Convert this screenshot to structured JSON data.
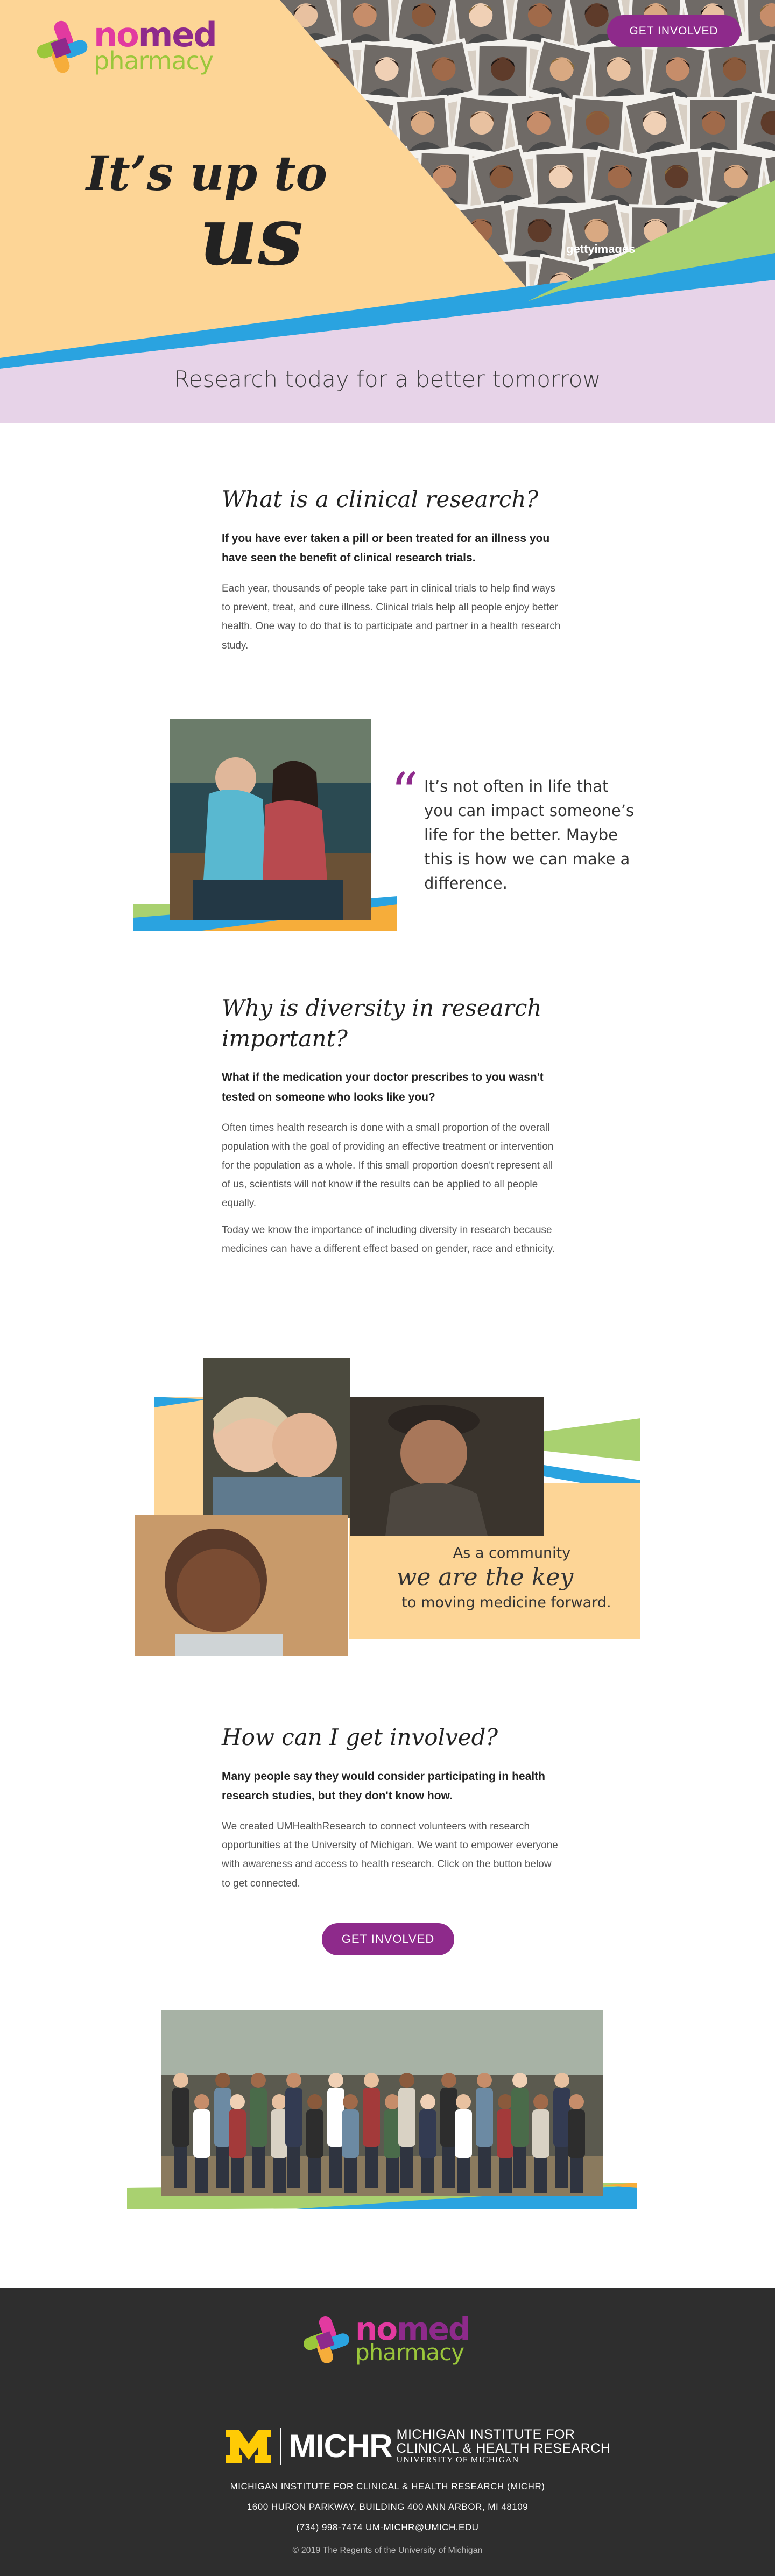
{
  "brand": {
    "logo_no": "no",
    "logo_med": "med",
    "logo_pharmacy": "pharmacy"
  },
  "header": {
    "cta_label": "GET INVOLVED"
  },
  "hero": {
    "title_line1": "It’s up to",
    "title_line2": "us",
    "tagline": "Research today for a better tomorrow",
    "watermark": "gettyimages"
  },
  "section_clinical": {
    "heading": "What is a clinical research?",
    "lead": "If you have ever taken a pill or been treated for an illness you have seen the benefit of clinical research trials.",
    "body": "Each year, thousands of people take part in clinical trials to help find ways to prevent, treat, and cure illness. Clinical trials help all people enjoy better health. One way to do that is to participate and partner in a health research study."
  },
  "quote": {
    "mark": "“",
    "text": "It’s not often in life that you can impact someone’s life for the better. Maybe this is how we can make a difference."
  },
  "section_diversity": {
    "heading": "Why is diversity in research important?",
    "lead": "What if the medication your doctor prescribes to you wasn't tested on someone who looks like you?",
    "body1": "Often times health research is done with a small proportion of the overall population with the goal of providing an effective treatment or intervention for the population as a whole. If this small proportion doesn't represent all of us, scientists will not know if the results can be applied to all people equally.",
    "body2": "Today we know the importance of including diversity in research because medicines can have a different effect based on gender, race and ethnicity."
  },
  "community": {
    "line1": "As a community",
    "line2": "we are the key",
    "line3": "to moving medicine forward."
  },
  "section_involved": {
    "heading": "How can I get involved?",
    "lead": "Many people say they would consider participating in health research studies, but they don't know how.",
    "body": "We created UMHealthResearch to connect volunteers with research opportunities at the University of Michigan. We want to empower everyone with awareness and access to health research. Click on the button below to get connected.",
    "cta_label": "GET INVOLVED"
  },
  "footer": {
    "michr_abbr": "MICHR",
    "michr_line1": "MICHIGAN INSTITUTE FOR",
    "michr_line2": "CLINICAL & HEALTH RESEARCH",
    "michr_line3": "UNIVERSITY OF MICHIGAN",
    "address_name": "MICHIGAN INSTITUTE FOR CLINICAL & HEALTH RESEARCH (MICHR)",
    "address_street": "1600 HURON PARKWAY, BUILDING 400 ANN ARBOR, MI 48109",
    "contact": "(734) 998-7474 UM-MICHR@UMICH.EDU",
    "copyright": "© 2019 The Regents of the University of Michigan"
  },
  "colors": {
    "peach": "#fdd596",
    "lavender": "#e7d3e8",
    "purple": "#8e2a8b",
    "blue": "#2aa3e0",
    "green": "#a9d170",
    "orange": "#f6ad3a",
    "footer_bg": "#2e2e2e"
  },
  "icons": {
    "logo_mark": "bandage-cross-icon",
    "quote": "quote-icon",
    "michigan": "block-m-icon"
  }
}
